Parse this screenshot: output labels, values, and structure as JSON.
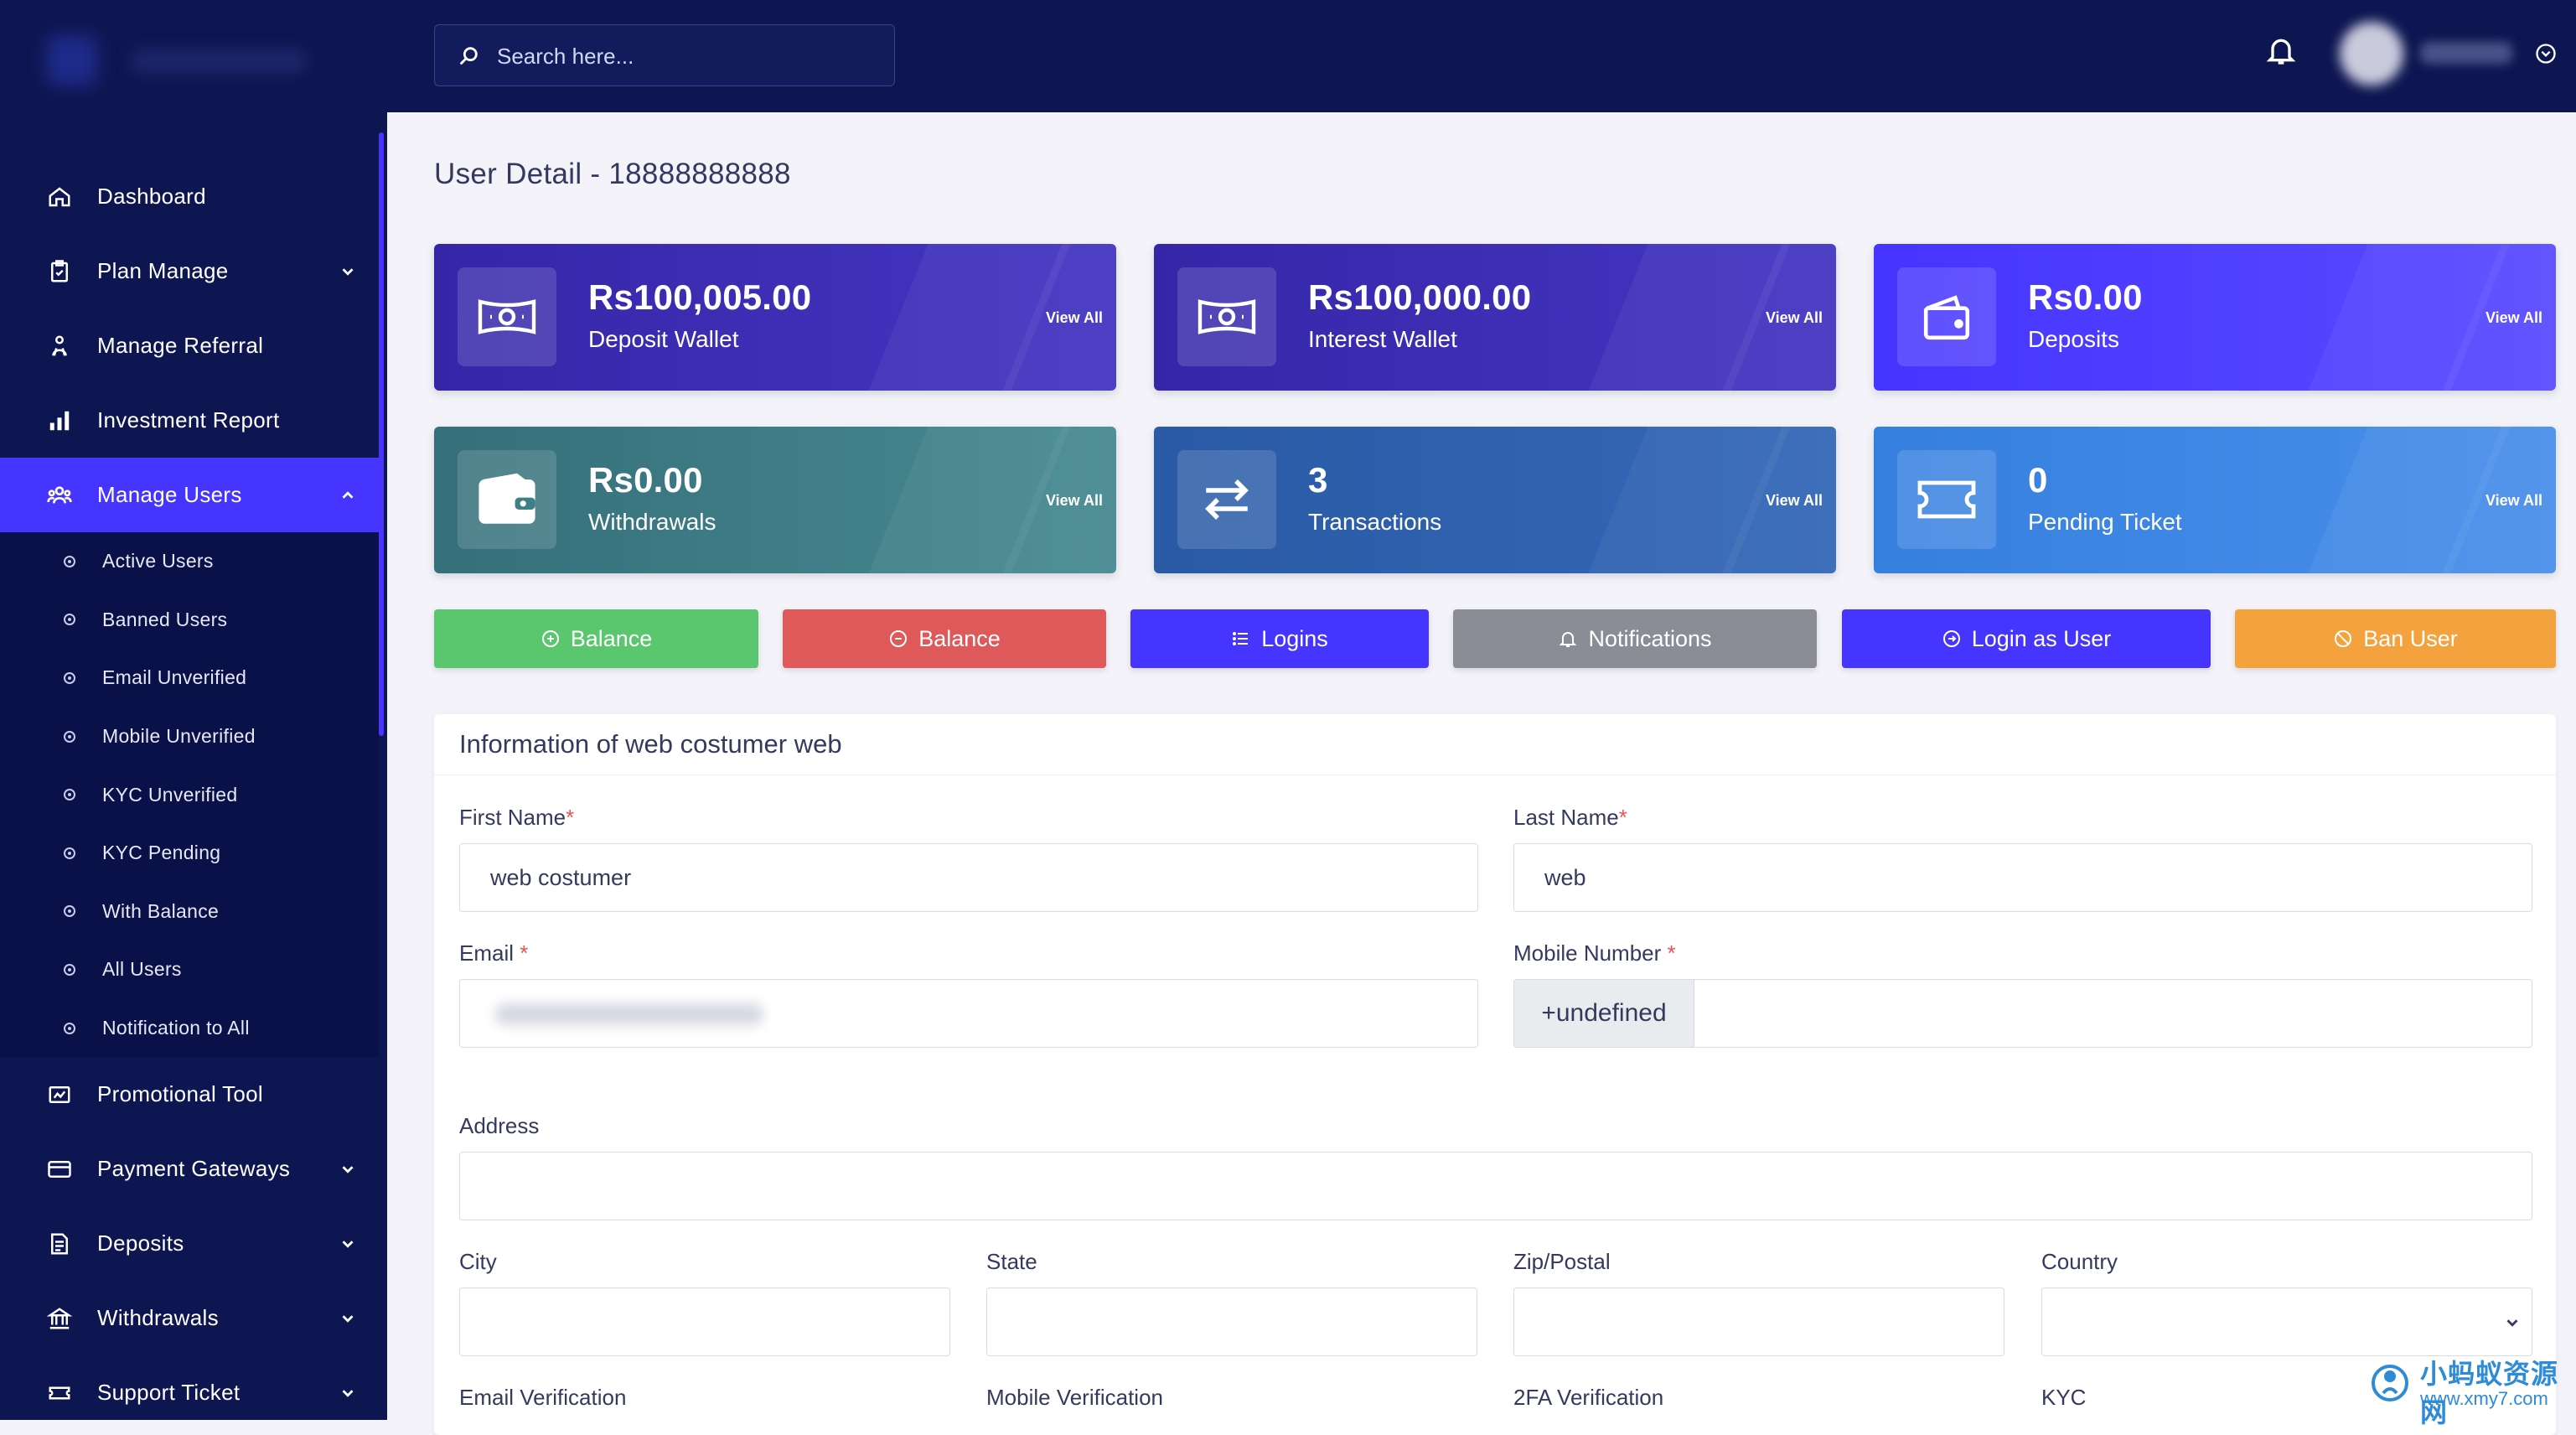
{
  "sidebar": {
    "items": [
      {
        "label": "Dashboard",
        "icon": "home-icon",
        "has_chevron": false
      },
      {
        "label": "Plan Manage",
        "icon": "clipboard-icon",
        "has_chevron": true
      },
      {
        "label": "Manage Referral",
        "icon": "referral-icon",
        "has_chevron": false
      },
      {
        "label": "Investment Report",
        "icon": "bar-chart-icon",
        "has_chevron": false
      },
      {
        "label": "Manage Users",
        "icon": "users-icon",
        "has_chevron": true,
        "active": true
      }
    ],
    "sub_items": [
      "Active Users",
      "Banned Users",
      "Email Unverified",
      "Mobile Unverified",
      "KYC Unverified",
      "KYC Pending",
      "With Balance",
      "All Users",
      "Notification to All"
    ],
    "items_after": [
      {
        "label": "Promotional Tool",
        "icon": "promo-icon",
        "has_chevron": false
      },
      {
        "label": "Payment Gateways",
        "icon": "credit-card-icon",
        "has_chevron": true
      },
      {
        "label": "Deposits",
        "icon": "receipt-icon",
        "has_chevron": true
      },
      {
        "label": "Withdrawals",
        "icon": "bank-icon",
        "has_chevron": true
      },
      {
        "label": "Support Ticket",
        "icon": "ticket-icon",
        "has_chevron": true
      }
    ]
  },
  "topbar": {
    "search_placeholder": "Search here..."
  },
  "page": {
    "title": "User Detail - 18888888888"
  },
  "cards": [
    {
      "value": "Rs100,005.00",
      "label": "Deposit Wallet",
      "view": "View All",
      "icon": "money-bill-icon",
      "color": "#3a2bb0"
    },
    {
      "value": "Rs100,000.00",
      "label": "Interest Wallet",
      "view": "View All",
      "icon": "money-bill-icon",
      "color": "#3a2bb0"
    },
    {
      "value": "Rs0.00",
      "label": "Deposits",
      "view": "View All",
      "icon": "wallet-icon",
      "color": "#4634ff"
    },
    {
      "value": "Rs0.00",
      "label": "Withdrawals",
      "view": "View All",
      "icon": "wallet-filled-icon",
      "color": "#3d7a85"
    },
    {
      "value": "3",
      "label": "Transactions",
      "view": "View All",
      "icon": "exchange-icon",
      "color": "#2d5fa8"
    },
    {
      "value": "0",
      "label": "Pending Ticket",
      "view": "View All",
      "icon": "ticket-icon",
      "color": "#3b82e0"
    }
  ],
  "actions": [
    {
      "label": "Balance",
      "icon": "plus-circle-icon",
      "color": "#5ac66e"
    },
    {
      "label": "Balance",
      "icon": "minus-circle-icon",
      "color": "#e0595a"
    },
    {
      "label": "Logins",
      "icon": "list-icon",
      "color": "#4634ff"
    },
    {
      "label": "Notifications",
      "icon": "bell-icon",
      "color": "#8a8d95"
    },
    {
      "label": "Login as User",
      "icon": "login-icon",
      "color": "#4634ff"
    },
    {
      "label": "Ban User",
      "icon": "ban-icon",
      "color": "#f4a23e"
    }
  ],
  "form": {
    "title": "Information of web costumer web",
    "first_name_label": "First Name",
    "first_name_value": "web costumer",
    "last_name_label": "Last Name",
    "last_name_value": "web",
    "email_label": "Email",
    "mobile_label": "Mobile Number",
    "mobile_prefix": "+undefined",
    "address_label": "Address",
    "city_label": "City",
    "state_label": "State",
    "zip_label": "Zip/Postal",
    "country_label": "Country",
    "email_verification_label": "Email Verification",
    "mobile_verification_label": "Mobile Verification",
    "twofa_label": "2FA Verification",
    "kyc_label": "KYC",
    "required_mark": "*"
  },
  "watermark": {
    "line1": "小蚂蚁资源网",
    "line2": "www.xmy7.com"
  }
}
